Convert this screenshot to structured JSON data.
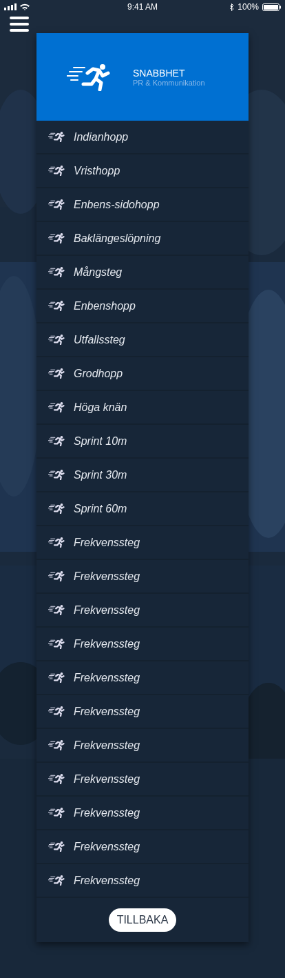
{
  "status_bar": {
    "time": "9:41 AM",
    "battery": "100%"
  },
  "header": {
    "title": "SNABBHET",
    "subtitle": "PR & Kommunikation"
  },
  "exercises": [
    "Indianhopp",
    "Vristhopp",
    "Enbens-sidohopp",
    "Baklängeslöpning",
    "Mångsteg",
    "Enbenshopp",
    "Utfallssteg",
    "Grodhopp",
    "Höga knän",
    "Sprint 10m",
    "Sprint 30m",
    "Sprint 60m",
    "Frekvenssteg",
    "Frekvenssteg",
    "Frekvenssteg",
    "Frekvenssteg",
    "Frekvenssteg",
    "Frekvenssteg",
    "Frekvenssteg",
    "Frekvenssteg",
    "Frekvenssteg",
    "Frekvenssteg",
    "Frekvenssteg"
  ],
  "back_button": "TILLBAKA"
}
